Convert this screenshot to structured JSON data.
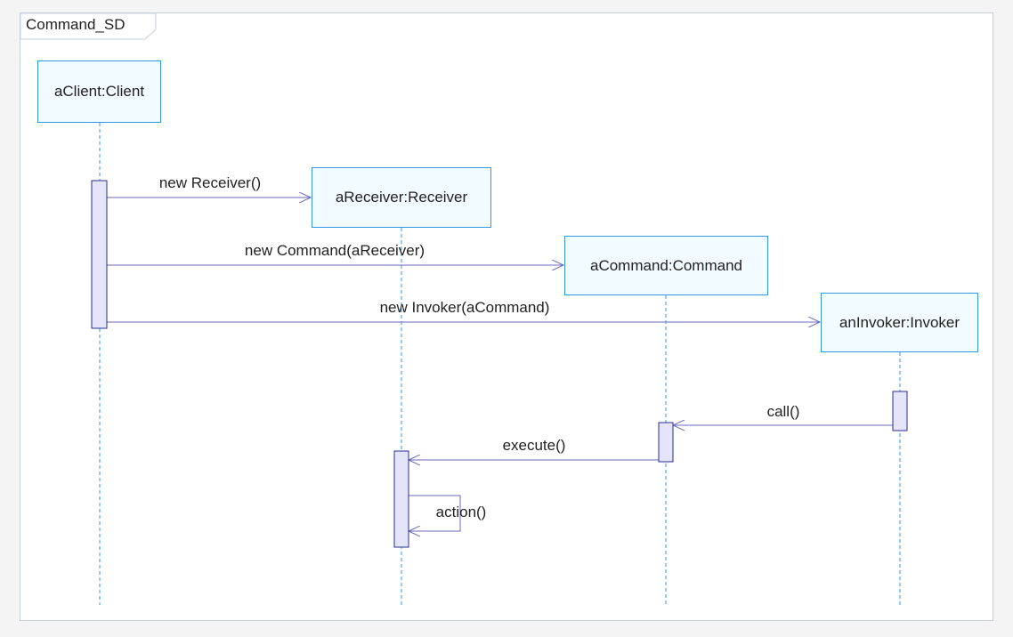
{
  "diagram": {
    "title": "Command_SD",
    "colors": {
      "lifeline": "#3399e6",
      "message": "#6b6bb8",
      "activation_fill": "#e4e4fa",
      "activation_border": "#2b2b8f",
      "frame_border": "#c9cfd8"
    },
    "lifelines": [
      {
        "id": "client",
        "label": "aClient:Client"
      },
      {
        "id": "receiver",
        "label": "aReceiver:Receiver"
      },
      {
        "id": "command",
        "label": "aCommand:Command"
      },
      {
        "id": "invoker",
        "label": "anInvoker:Invoker"
      }
    ],
    "messages": [
      {
        "id": "new-receiver",
        "label": "new Receiver()",
        "from": "client",
        "to": "receiver"
      },
      {
        "id": "new-command",
        "label": "new Command(aReceiver)",
        "from": "client",
        "to": "command"
      },
      {
        "id": "new-invoker",
        "label": "new Invoker(aCommand)",
        "from": "client",
        "to": "invoker"
      },
      {
        "id": "call",
        "label": "call()",
        "from": "invoker",
        "to": "command"
      },
      {
        "id": "execute",
        "label": "execute()",
        "from": "command",
        "to": "receiver"
      },
      {
        "id": "action",
        "label": "action()",
        "from": "receiver",
        "to": "receiver"
      }
    ]
  }
}
